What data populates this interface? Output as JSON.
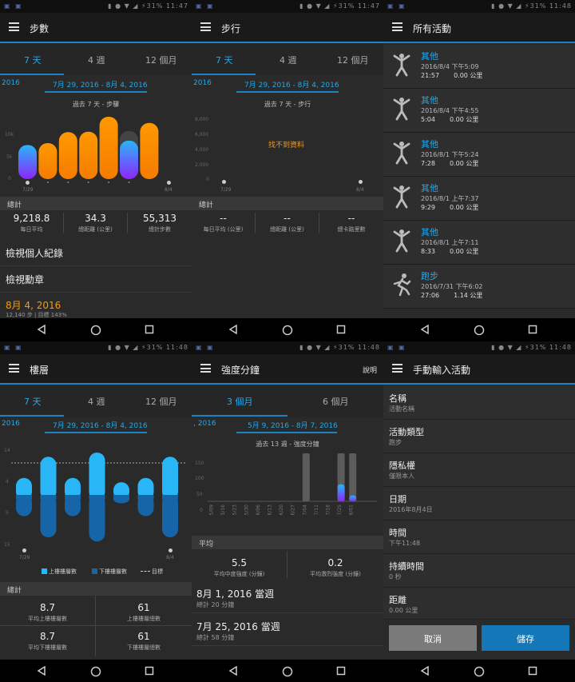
{
  "status_bar": {
    "left_icons": "▣ ▣",
    "right_text_1": "▮ ● ▼ ◢ ⚡31% 11:47",
    "right_text_2": "▮ ● ▼ ◢ ⚡31% 11:47",
    "right_text_3": "▮ ● ▼ ◢ ⚡31% 11:48",
    "right_text_4": "▮ ● ▼ ◢ ⚡31% 11:48",
    "right_text_5": "▮ ● ▼ ◢ ⚡31% 11:48",
    "right_text_6": "▮ ● ▼ ◢ ⚡31% 11:48"
  },
  "steps": {
    "title": "步數",
    "tabs": [
      "7 天",
      "4 週",
      "12 個月"
    ],
    "range_year": "2016",
    "range": "7月 29, 2016 - 8月 4, 2016",
    "subtitle": "過去 7 天 - 步驟",
    "y_ticks": [
      "10k",
      "5k",
      "0"
    ],
    "x_start": "7/29",
    "x_end": "8/4",
    "section": "總計",
    "stats": [
      {
        "value": "9,218.8",
        "label": "每日平均"
      },
      {
        "value": "34.3",
        "label": "總距離 (公里)"
      },
      {
        "value": "55,313",
        "label": "總計步數"
      }
    ],
    "links": [
      "檢視個人紀錄",
      "檢視勳章"
    ],
    "date": "8月 4, 2016",
    "date_sub": "12,140 步 | 目標 143%"
  },
  "walking": {
    "title": "步行",
    "tabs": [
      "7 天",
      "4 週",
      "12 個月"
    ],
    "range_year": "2016",
    "range": "7月 29, 2016 - 8月 4, 2016",
    "subtitle": "過去 7 天 - 步行",
    "y_ticks": [
      "8,000",
      "6,000",
      "4,000",
      "2,000",
      "0"
    ],
    "no_data": "找不到資料",
    "x_start": "7/29",
    "x_end": "8/4",
    "section": "總計",
    "stats": [
      {
        "value": "--",
        "label": "每日平均 (公里)"
      },
      {
        "value": "--",
        "label": "總距離 (公里)"
      },
      {
        "value": "--",
        "label": "總卡路里數"
      }
    ]
  },
  "activities": {
    "title": "所有活動",
    "items": [
      {
        "name": "其他",
        "date": "2016/8/4 下午5:09",
        "time": "21:57",
        "dist": "0.00 公里",
        "icon": "other"
      },
      {
        "name": "其他",
        "date": "2016/8/4 下午4:55",
        "time": "5:04",
        "dist": "0.00 公里",
        "icon": "other"
      },
      {
        "name": "其他",
        "date": "2016/8/1 下午5:24",
        "time": "7:28",
        "dist": "0.00 公里",
        "icon": "other"
      },
      {
        "name": "其他",
        "date": "2016/8/1 上午7:37",
        "time": "9:29",
        "dist": "0.00 公里",
        "icon": "other"
      },
      {
        "name": "其他",
        "date": "2016/8/1 上午7:11",
        "time": "8:33",
        "dist": "0.00 公里",
        "icon": "other"
      },
      {
        "name": "跑步",
        "date": "2016/7/31 下午6:02",
        "time": "27:06",
        "dist": "1.14 公里",
        "icon": "run"
      }
    ]
  },
  "floors": {
    "title": "樓層",
    "tabs": [
      "7 天",
      "4 週",
      "12 個月"
    ],
    "range_year": "2016",
    "range": "7月 29, 2016 - 8月 4, 2016",
    "y_ticks": [
      "14",
      "4",
      "5",
      "15"
    ],
    "x_start": "7/29",
    "x_end": "8/4",
    "legend": [
      "上樓樓層數",
      "下樓樓層數",
      "目標"
    ],
    "section": "總計",
    "stats": [
      {
        "value": "8.7",
        "label": "平均上樓樓層數"
      },
      {
        "value": "61",
        "label": "上樓樓層總數"
      },
      {
        "value": "8.7",
        "label": "平均下樓樓層數"
      },
      {
        "value": "61",
        "label": "下樓樓層總數"
      }
    ]
  },
  "intensity": {
    "title": "強度分鐘",
    "help": "說明",
    "tabs": [
      "3 個月",
      "6 個月"
    ],
    "range_year": ", 2016",
    "range": "5月 9, 2016 - 8月 7, 2016",
    "subtitle": "過去 13 週 - 強度分鐘",
    "y_ticks": [
      "150",
      "100",
      "50",
      "0"
    ],
    "x_labels": [
      "5/09",
      "5/16",
      "5/23",
      "5/30",
      "6/06",
      "6/13",
      "6/20",
      "6/27",
      "7/04",
      "7/11",
      "7/18",
      "7/25",
      "8/01"
    ],
    "section": "平均",
    "stats": [
      {
        "value": "5.5",
        "label": "平均中度強度 (分鐘)"
      },
      {
        "value": "0.2",
        "label": "平均激烈強度 (分鐘)"
      }
    ],
    "weeks": [
      {
        "title": "8月 1, 2016 當週",
        "sub": "總計 20 分鐘"
      },
      {
        "title": "7月 25, 2016 當週",
        "sub": "總計 58 分鐘"
      }
    ]
  },
  "manual": {
    "title": "手動輸入活動",
    "fields": [
      {
        "label": "名稱",
        "value": "活動名稱"
      },
      {
        "label": "活動類型",
        "value": "跑步"
      },
      {
        "label": "隱私權",
        "value": "僅限本人"
      },
      {
        "label": "日期",
        "value": "2016年8月4日"
      },
      {
        "label": "時間",
        "value": "下午11:48"
      },
      {
        "label": "持續時間",
        "value": "0 秒"
      },
      {
        "label": "距離",
        "value": "0.00 公里"
      }
    ],
    "cancel": "取消",
    "save": "儲存"
  },
  "chart_data": [
    {
      "type": "bar",
      "title": "過去 7 天 - 步驟",
      "categories": [
        "7/29",
        "7/30",
        "7/31",
        "8/1",
        "8/2",
        "8/3",
        "8/4"
      ],
      "values": [
        9300,
        9800,
        12800,
        12900,
        17000,
        10500,
        15300
      ],
      "ylim": [
        0,
        17000
      ]
    },
    {
      "type": "bar",
      "title": "樓層",
      "categories": [
        "7/29",
        "7/30",
        "7/31",
        "8/1",
        "8/2",
        "8/3",
        "8/4"
      ],
      "series": [
        {
          "name": "上樓樓層數",
          "values": [
            4,
            9,
            4,
            10,
            3,
            4,
            9
          ]
        },
        {
          "name": "下樓樓層數",
          "values": [
            5,
            10,
            5,
            11,
            2,
            5,
            10
          ]
        }
      ]
    },
    {
      "type": "bar",
      "title": "過去 13 週 - 強度分鐘",
      "categories": [
        "5/09",
        "5/16",
        "5/23",
        "5/30",
        "6/06",
        "6/13",
        "6/20",
        "6/27",
        "7/04",
        "7/11",
        "7/18",
        "7/25",
        "8/01"
      ],
      "series": [
        {
          "name": "total",
          "values": [
            0,
            0,
            0,
            0,
            0,
            0,
            0,
            0,
            0,
            0,
            0,
            58,
            20
          ]
        }
      ],
      "ylim": [
        0,
        150
      ]
    }
  ]
}
